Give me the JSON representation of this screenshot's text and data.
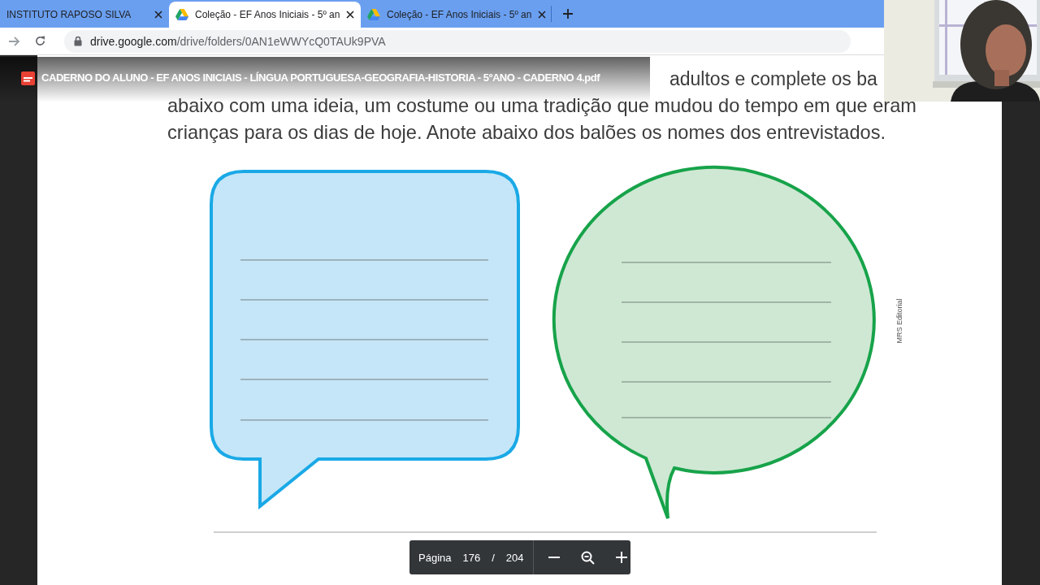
{
  "tabs": [
    {
      "title": "INSTITUTO RAPOSO SILVA",
      "selected": false
    },
    {
      "title": "Coleção - EF Anos Iniciais - 5º an",
      "selected": true
    },
    {
      "title": "Coleção - EF Anos Iniciais - 5º an",
      "selected": false
    }
  ],
  "address": {
    "host": "drive.google.com",
    "path": "/drive/folders/0AN1eWWYcQ0TAUk9PVA"
  },
  "viewer": {
    "file_title": "CADERNO DO ALUNO - EF ANOS INICIAIS - LÍNGUA PORTUGUESA-GEOGRAFIA-HISTORIA - 5ºANO - CADERNO 4.pdf",
    "page_text_fragment": "adultos e complete os ba",
    "page_text": [
      "abaixo com uma ideia, um costume ou uma tradição que mudou do tempo em que eram",
      "crianças para os dias de hoje. Anote abaixo dos balões os nomes dos entrevistados."
    ],
    "balloons": [
      {
        "kind": "square",
        "color": "#1aa9e6"
      },
      {
        "kind": "round",
        "color": "#17a34a"
      }
    ],
    "credit": "MRS Editorial",
    "toolbar": {
      "label": "Página",
      "page": "176",
      "separator": "/",
      "total": "204"
    }
  }
}
